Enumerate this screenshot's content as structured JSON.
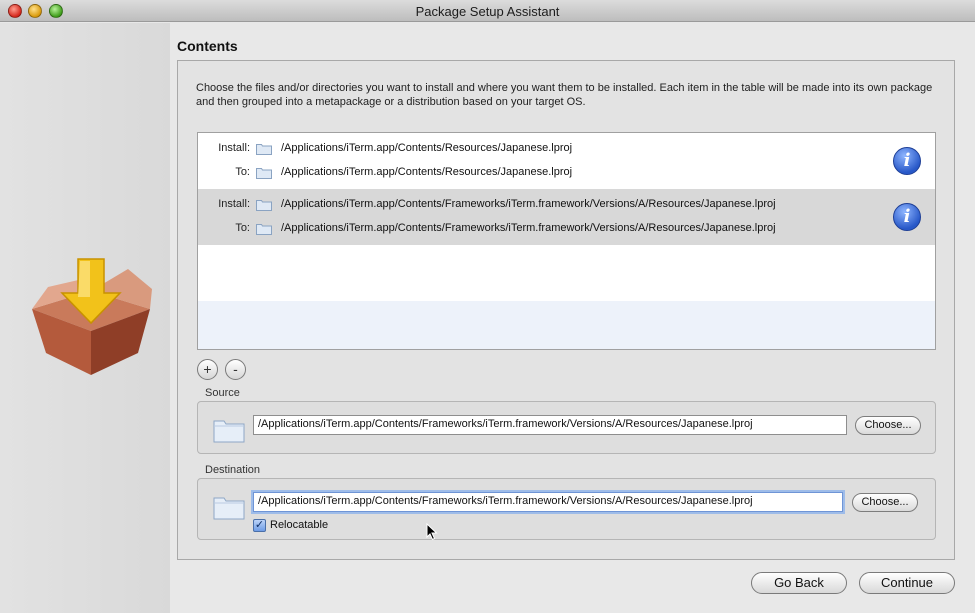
{
  "window": {
    "title": "Package Setup Assistant"
  },
  "section": {
    "title": "Contents",
    "description": "Choose the files and/or directories you want to install and where you want them to be installed. Each item in the table will be made into its own package and then grouped into a metapackage or a distribution based on your target OS."
  },
  "table": {
    "install_label": "Install:",
    "to_label": "To:",
    "info_glyph": "i",
    "rows": [
      {
        "install": "/Applications/iTerm.app/Contents/Resources/Japanese.lproj",
        "to": "/Applications/iTerm.app/Contents/Resources/Japanese.lproj"
      },
      {
        "install": "/Applications/iTerm.app/Contents/Frameworks/iTerm.framework/Versions/A/Resources/Japanese.lproj",
        "to": "/Applications/iTerm.app/Contents/Frameworks/iTerm.framework/Versions/A/Resources/Japanese.lproj"
      }
    ]
  },
  "controls": {
    "add_glyph": "+",
    "remove_glyph": "-"
  },
  "source": {
    "label": "Source",
    "path": "/Applications/iTerm.app/Contents/Frameworks/iTerm.framework/Versions/A/Resources/Japanese.lproj",
    "choose_label": "Choose..."
  },
  "destination": {
    "label": "Destination",
    "path": "/Applications/iTerm.app/Contents/Frameworks/iTerm.framework/Versions/A/Resources/Japanese.lproj",
    "choose_label": "Choose...",
    "relocatable_label": "Relocatable",
    "relocatable_checked": true
  },
  "footer": {
    "back_label": "Go Back",
    "continue_label": "Continue"
  },
  "icons": {
    "package": "package-install-icon",
    "folder": "folder-icon",
    "info": "info-icon",
    "cursor": "mouse-cursor-icon"
  }
}
